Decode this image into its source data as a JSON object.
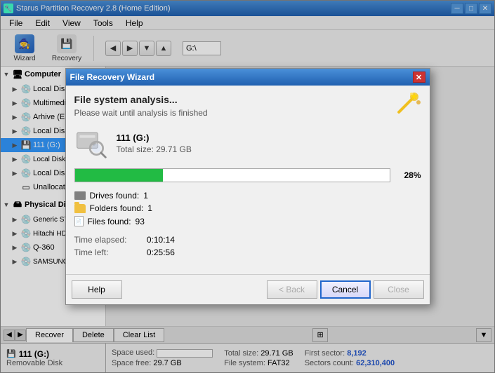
{
  "app": {
    "title": "Starus Partition Recovery 2.8 (Home Edition)",
    "icon": "🔧"
  },
  "menu": {
    "items": [
      "File",
      "Edit",
      "View",
      "Tools",
      "Help"
    ]
  },
  "toolbar": {
    "wizard_label": "Wizard",
    "recovery_label": "Recovery",
    "address_value": "G:\\"
  },
  "tree": {
    "sections": [
      {
        "label": "Computer",
        "items": [
          {
            "label": "Local Disk (C:)",
            "indent": 1,
            "expanded": false
          },
          {
            "label": "Multimedia (D:)",
            "indent": 1,
            "expanded": false
          },
          {
            "label": "Arhive (E:)",
            "indent": 1,
            "expanded": false
          },
          {
            "label": "Local Disk (F:)",
            "indent": 1,
            "expanded": false
          },
          {
            "label": "111 (G:)",
            "indent": 1,
            "expanded": false,
            "selected": true
          },
          {
            "label": "Local Disk 0 (3apes",
            "indent": 1,
            "expanded": false
          },
          {
            "label": "Local Disk 1",
            "indent": 1,
            "expanded": false
          },
          {
            "label": "Unallocated space",
            "indent": 1,
            "expanded": false
          }
        ]
      },
      {
        "label": "Physical Disks",
        "items": [
          {
            "label": "Generic STORAGE D",
            "indent": 1
          },
          {
            "label": "Hitachi HDP72501G",
            "indent": 1
          },
          {
            "label": "Q-360",
            "indent": 1
          },
          {
            "label": "SAMSUNG HD502H",
            "indent": 1
          }
        ]
      }
    ]
  },
  "dialog": {
    "title": "File Recovery Wizard",
    "heading": "File system analysis...",
    "subtext": "Please wait until analysis is finished",
    "drive": {
      "name": "111 (G:)",
      "total_size": "Total size: 29.71 GB"
    },
    "progress": {
      "percent": 28,
      "percent_label": "28%",
      "fill_width": "28%"
    },
    "found": {
      "drives_label": "Drives found:",
      "drives_value": "1",
      "folders_label": "Folders found:",
      "folders_value": "1",
      "files_label": "Files found:",
      "files_value": "93"
    },
    "time": {
      "elapsed_label": "Time elapsed:",
      "elapsed_value": "0:10:14",
      "left_label": "Time left:",
      "left_value": "0:25:56"
    },
    "buttons": {
      "help": "Help",
      "back": "< Back",
      "cancel": "Cancel",
      "close": "Close"
    }
  },
  "bottom_tabs": {
    "items": [
      "Recover",
      "Delete",
      "Clear List"
    ]
  },
  "status": {
    "drive_name": "111 (G:)",
    "drive_type": "Removable Disk",
    "space_used_label": "Space used:",
    "space_free_label": "Space free:",
    "space_free_value": "29.7 GB",
    "total_size_label": "Total size:",
    "total_size_value": "29.71 GB",
    "filesystem_label": "File system:",
    "filesystem_value": "FAT32",
    "first_sector_label": "First sector:",
    "first_sector_value": "8,192",
    "sectors_count_label": "Sectors count:",
    "sectors_count_value": "62,310,400"
  }
}
